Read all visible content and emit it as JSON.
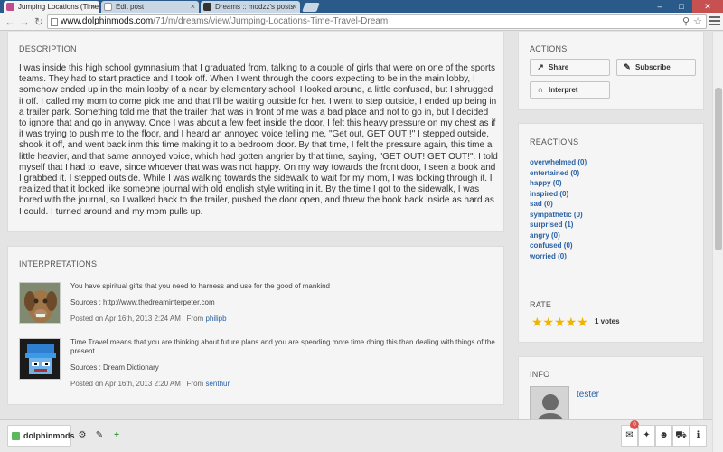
{
  "browser": {
    "tabs": [
      {
        "title": "Jumping Locations (Time",
        "active": true,
        "favicon_color": "#c44c8c"
      },
      {
        "title": "Edit post",
        "active": false,
        "favicon_color": "#ffffff"
      },
      {
        "title": "Dreams :: modzz's posts",
        "active": false,
        "favicon_color": "#333333"
      }
    ],
    "url_host": "www.dolphinmods.com",
    "url_path": "/71/m/dreams/view/Jumping-Locations-Time-Travel-Dream"
  },
  "description": {
    "heading": "DESCRIPTION",
    "text": "I was inside this high school gymnasium that I graduated from, talking to a couple of girls that were on one of the sports teams. They had to start practice and I took off. When I went through the doors expecting to be in the main lobby, I somehow ended up in the main lobby of a near by elementary school. I looked around, a little confused, but I shrugged it off. I called my mom to come pick me and that I'll be waiting outside for her. I went to step outside, I ended up being in a trailer park. Something told me that the trailer that was in front of me was a bad place and not to go in, but I decided to ignore that and go in anyway. Once I was about a few feet inside the door, I felt this heavy pressure on my chest as if it was trying to push me to the floor, and I heard an annoyed voice telling me, \"Get out, GET OUT!!\" I stepped outside, shook it off, and went back inm this time making it to a bedroom door. By that time, I felt the pressure again, this time a little heavier, and that same annoyed voice, which had gotten angrier by that time, saying, \"GET OUT! GET OUT!\". I told myself that I had to leave, since whoever that was was not happy. On my way towards the front door, I seen a book and I grabbed it. I stepped outside. While I was walking towards the sidewalk to wait for my mom, I was looking through it. I realized that it looked like someone journal with old english style writing in it. By the time I got to the sidewalk, I was bored with the journal, so I walked back to the trailer, pushed the door open, and threw the book back inside as hard as I could. I turned around and my mom pulls up."
  },
  "interpretations": {
    "heading": "INTERPRETATIONS",
    "items": [
      {
        "text": "You have spiritual gifts that you need to harness and use for the good of mankind",
        "source": "Sources : http://www.thedreaminterpeter.com",
        "posted": "Posted on Apr 16th, 2013 2:24 AM",
        "from_label": "From",
        "user": "philipb"
      },
      {
        "text": "Time Travel means that you are thinking about future plans and you are spending more time doing this than dealing with things of the present",
        "source": "Sources : Dream Dictionary",
        "posted": "Posted on Apr 16th, 2013 2:20 AM",
        "from_label": "From",
        "user": "senthur"
      }
    ]
  },
  "actions": {
    "heading": "ACTIONS",
    "share": "Share",
    "subscribe": "Subscribe",
    "interpret": "Interpret"
  },
  "reactions": {
    "heading": "REACTIONS",
    "items": [
      "overwhelmed (0)",
      "entertained (0)",
      "happy (0)",
      "inspired (0)",
      "sad (0)",
      "sympathetic (0)",
      "surprised (1)",
      "angry (0)",
      "confused (0)",
      "worried (0)"
    ]
  },
  "rate": {
    "heading": "RATE",
    "stars": 5,
    "votes": "1 votes"
  },
  "info": {
    "heading": "INFO",
    "username": "tester"
  },
  "bottombar": {
    "brand": "dolphinmods",
    "notification_count": "0"
  },
  "colors": {
    "link": "#2a62a5",
    "star": "#f0b400",
    "brand_green": "#5cb85c"
  }
}
